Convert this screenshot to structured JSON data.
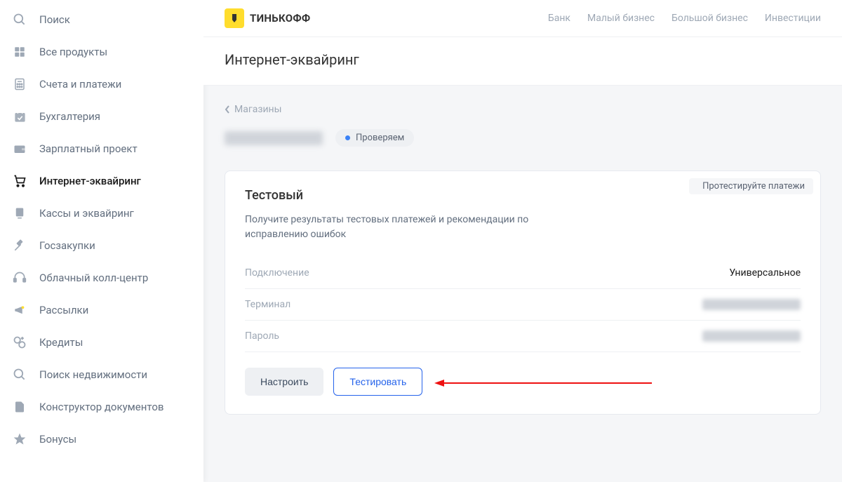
{
  "brand": "ТИНЬКОФФ",
  "nav": [
    "Банк",
    "Малый бизнес",
    "Большой бизнес",
    "Инвестиции"
  ],
  "page_title": "Интернет-эквайринг",
  "sidebar": {
    "items": [
      {
        "label": "Поиск",
        "icon": "search-icon"
      },
      {
        "label": "Все продукты",
        "icon": "grid-icon"
      },
      {
        "label": "Счета и платежи",
        "icon": "calculator-icon"
      },
      {
        "label": "Бухгалтерия",
        "icon": "calendar-icon"
      },
      {
        "label": "Зарплатный проект",
        "icon": "wallet-icon"
      },
      {
        "label": "Интернет-эквайринг",
        "icon": "cart-icon",
        "active": true
      },
      {
        "label": "Кассы и эквайринг",
        "icon": "terminal-icon"
      },
      {
        "label": "Госзакупки",
        "icon": "gavel-icon"
      },
      {
        "label": "Облачный колл-центр",
        "icon": "headset-icon"
      },
      {
        "label": "Рассылки",
        "icon": "megaphone-icon"
      },
      {
        "label": "Кредиты",
        "icon": "link-icon"
      },
      {
        "label": "Поиск недвижимости",
        "icon": "search-house-icon"
      },
      {
        "label": "Конструктор документов",
        "icon": "document-icon"
      },
      {
        "label": "Бонусы",
        "icon": "star-icon"
      }
    ]
  },
  "breadcrumb": {
    "label": "Магазины"
  },
  "shop_status": {
    "label": "Проверяем"
  },
  "card": {
    "badge": "Протестируйте платежи",
    "title": "Тестовый",
    "desc": "Получите результаты тестовых платежей и рекомендации по исправлению ошибок",
    "rows": {
      "connection": {
        "key": "Подключение",
        "val": "Универсальное"
      },
      "terminal": {
        "key": "Терминал"
      },
      "password": {
        "key": "Пароль"
      }
    },
    "btn_configure": "Настроить",
    "btn_test": "Тестировать"
  }
}
